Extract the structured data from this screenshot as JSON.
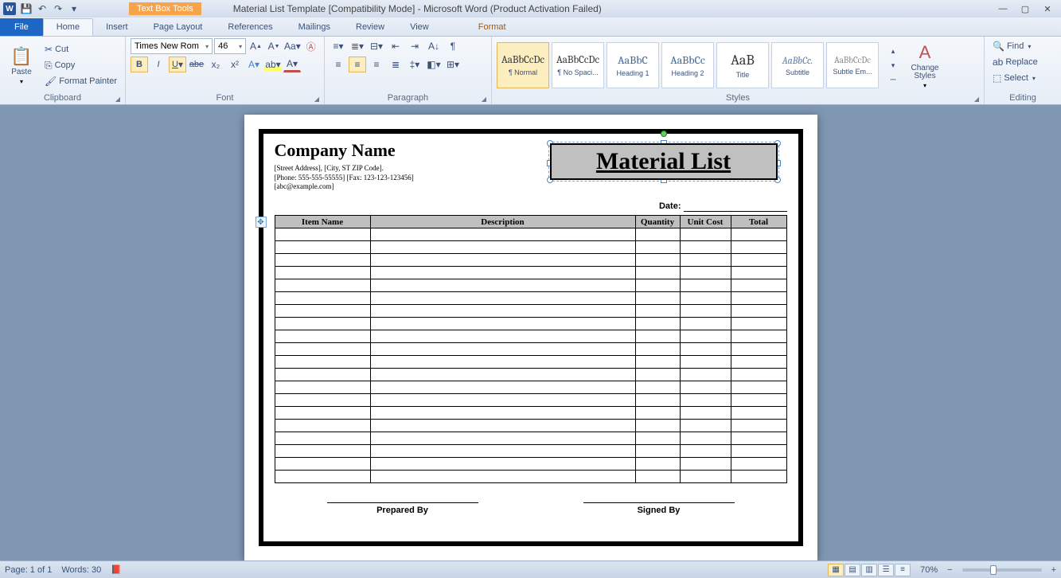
{
  "app": {
    "title": "Material List Template [Compatibility Mode] - Microsoft Word (Product Activation Failed)",
    "contextual_group": "Text Box Tools"
  },
  "qat": {
    "save": "💾",
    "undo": "↶",
    "redo": "↷"
  },
  "tabs": {
    "file": "File",
    "home": "Home",
    "insert": "Insert",
    "page_layout": "Page Layout",
    "references": "References",
    "mailings": "Mailings",
    "review": "Review",
    "view": "View",
    "format": "Format"
  },
  "ribbon": {
    "clipboard": {
      "label": "Clipboard",
      "paste": "Paste",
      "cut": "Cut",
      "copy": "Copy",
      "format_painter": "Format Painter"
    },
    "font": {
      "label": "Font",
      "name": "Times New Rom",
      "size": "46"
    },
    "paragraph": {
      "label": "Paragraph"
    },
    "styles": {
      "label": "Styles",
      "items": [
        {
          "preview": "AaBbCcDc",
          "name": "¶ Normal",
          "cls": "",
          "sel": true
        },
        {
          "preview": "AaBbCcDc",
          "name": "¶ No Spaci...",
          "cls": ""
        },
        {
          "preview": "AaBbC",
          "name": "Heading 1",
          "cls": "h1"
        },
        {
          "preview": "AaBbCc",
          "name": "Heading 2",
          "cls": "h1"
        },
        {
          "preview": "AaB",
          "name": "Title",
          "cls": "ttl"
        },
        {
          "preview": "AaBbCc.",
          "name": "Subtitle",
          "cls": "sub"
        },
        {
          "preview": "AaBbCcDc",
          "name": "Subtle Em...",
          "cls": "se"
        }
      ],
      "change": "Change Styles"
    },
    "editing": {
      "label": "Editing",
      "find": "Find",
      "replace": "Replace",
      "select": "Select"
    }
  },
  "document": {
    "company": "Company Name",
    "addr": "[Street Address], [City, ST ZIP Code].",
    "phone": "[Phone: 555-555-55555] [Fax: 123-123-123456]",
    "email": "[abc@example.com]",
    "textbox_title": "Material List",
    "date_label": "Date:",
    "columns": [
      "Item Name",
      "Description",
      "Quantity",
      "Unit Cost",
      "Total"
    ],
    "blank_rows": 20,
    "prepared": "Prepared  By",
    "signed": "Signed By"
  },
  "status": {
    "page": "Page: 1 of 1",
    "words": "Words: 30",
    "zoom": "70%"
  }
}
